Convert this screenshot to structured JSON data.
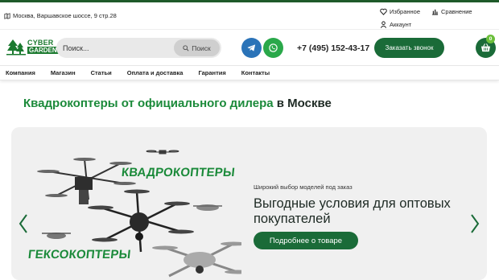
{
  "topbar": {
    "address": "Москва, Варшавское шоссе, 9 стр.28",
    "favorites": "Избранное",
    "compare": "Сравнение",
    "account": "Аккаунт"
  },
  "header": {
    "logo_top": "CYBER",
    "logo_bottom": "GARDEN",
    "search_placeholder": "Поиск...",
    "search_button": "Поиск",
    "phone": "+7 (495) 152-43-17",
    "callback": "Заказать звонок",
    "cart_count": "0"
  },
  "nav": {
    "items": [
      "Компания",
      "Магазин",
      "Статьи",
      "Оплата и доставка",
      "Гарантия",
      "Контакты"
    ]
  },
  "headline": {
    "green": "Квадрокоптеры от официального дилера",
    "dark": " в Москве"
  },
  "banner": {
    "label_quad": "КВАДРОКОПТЕРЫ",
    "label_hex": "ГЕКСОКОПТЕРЫ",
    "small_text": "Широкий выбор моделей под заказ",
    "title": "Выгодные условия для оптовых покупателей",
    "button": "Подробнее о товаре"
  },
  "colors": {
    "brand_green": "#1a6b38",
    "headline_green": "#1b8a3a",
    "telegram": "#2a73b8",
    "whatsapp": "#2aa84a",
    "badge": "#6bbf3a"
  },
  "icons": [
    "map-icon",
    "heart-icon",
    "chart-icon",
    "user-icon",
    "search-icon",
    "telegram-icon",
    "whatsapp-icon",
    "cart-icon",
    "chevron-left-icon",
    "chevron-right-icon"
  ]
}
